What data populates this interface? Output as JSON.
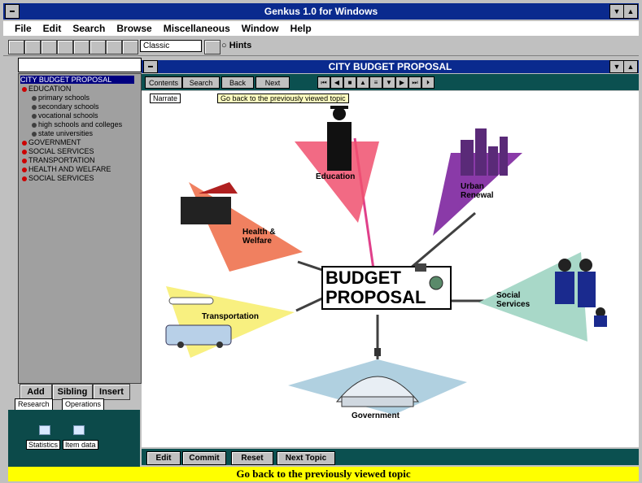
{
  "window": {
    "title": "Genkus 1.0 for Windows"
  },
  "menu": [
    "File",
    "Edit",
    "Search",
    "Browse",
    "Miscellaneous",
    "Window",
    "Help"
  ],
  "toolbar": {
    "combo_value": "Classic",
    "hints_label": "Hints"
  },
  "tree": {
    "root": "CITY BUDGET PROPOSAL",
    "items": [
      {
        "label": "EDUCATION",
        "level": 0
      },
      {
        "label": "primary schools",
        "level": 1
      },
      {
        "label": "secondary schools",
        "level": 1
      },
      {
        "label": "vocational schools",
        "level": 1
      },
      {
        "label": "high schools and colleges",
        "level": 1
      },
      {
        "label": "state universities",
        "level": 1
      },
      {
        "label": "GOVERNMENT",
        "level": 0
      },
      {
        "label": "SOCIAL SERVICES",
        "level": 0
      },
      {
        "label": "TRANSPORTATION",
        "level": 0
      },
      {
        "label": "HEALTH AND WELFARE",
        "level": 0
      },
      {
        "label": "SOCIAL SERVICES",
        "level": 0
      }
    ]
  },
  "left_buttons": [
    "Add",
    "Sibling",
    "Insert"
  ],
  "left_tabs": [
    "Research",
    "Operations"
  ],
  "left_icons": [
    {
      "label": "Statistics"
    },
    {
      "label": "Item data"
    }
  ],
  "document": {
    "title": "CITY BUDGET PROPOSAL",
    "buttons": [
      "Contents",
      "Search",
      "Back",
      "Next"
    ],
    "tooltip": "Go back to the previously viewed topic",
    "narrate": "Narrate",
    "center_line1": "BUDGET",
    "center_line2": "PROPOSAL",
    "branches": {
      "education": "Education",
      "urban": "Urban Renewal",
      "health": "Health & Welfare",
      "social": "Social Services",
      "transport": "Transportation",
      "government": "Government"
    },
    "colors": {
      "education": "#f0506e",
      "urban": "#8a3aa8",
      "health": "#f08060",
      "social": "#a8d8c8",
      "transport": "#f8f080",
      "government": "#b0d0e0"
    },
    "bottom_buttons": [
      "Edit",
      "Commit",
      "Reset",
      "Next Topic"
    ]
  },
  "status": "Go back to the previously viewed topic"
}
